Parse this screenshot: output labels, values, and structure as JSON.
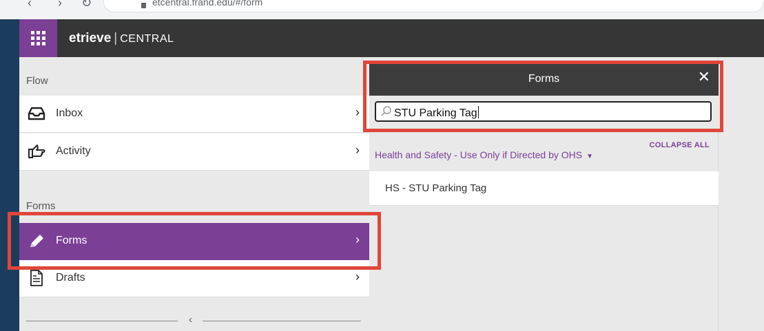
{
  "browser": {
    "url": "etcentral.frand.edu/#/form",
    "back": "‹",
    "forward": "›",
    "reload": "↻"
  },
  "header": {
    "logo": "etrieve",
    "separator": "|",
    "product": "CENTRAL"
  },
  "nav": {
    "flow_label": "Flow",
    "forms_label": "Forms",
    "items": [
      {
        "label": "Inbox",
        "icon": "inbox-icon",
        "chevron": "›"
      },
      {
        "label": "Activity",
        "icon": "pointing-hand-icon",
        "chevron": "›"
      },
      {
        "label": "Forms",
        "icon": "pencil-icon",
        "chevron": "›",
        "active": true
      },
      {
        "label": "Drafts",
        "icon": "document-icon",
        "chevron": "›"
      }
    ],
    "collapse_arrow": "‹"
  },
  "flyout": {
    "title": "Forms",
    "close": "✕",
    "search": {
      "value": "STU Parking Tag"
    },
    "collapse_all": "COLLAPSE ALL",
    "category": "Health and Safety - Use Only if Directed by OHS",
    "category_toggle": "▼",
    "results": [
      "HS - STU Parking Tag"
    ]
  },
  "colors": {
    "accent": "#7b3f96",
    "header": "#363636",
    "highlight": "#e0463b"
  }
}
